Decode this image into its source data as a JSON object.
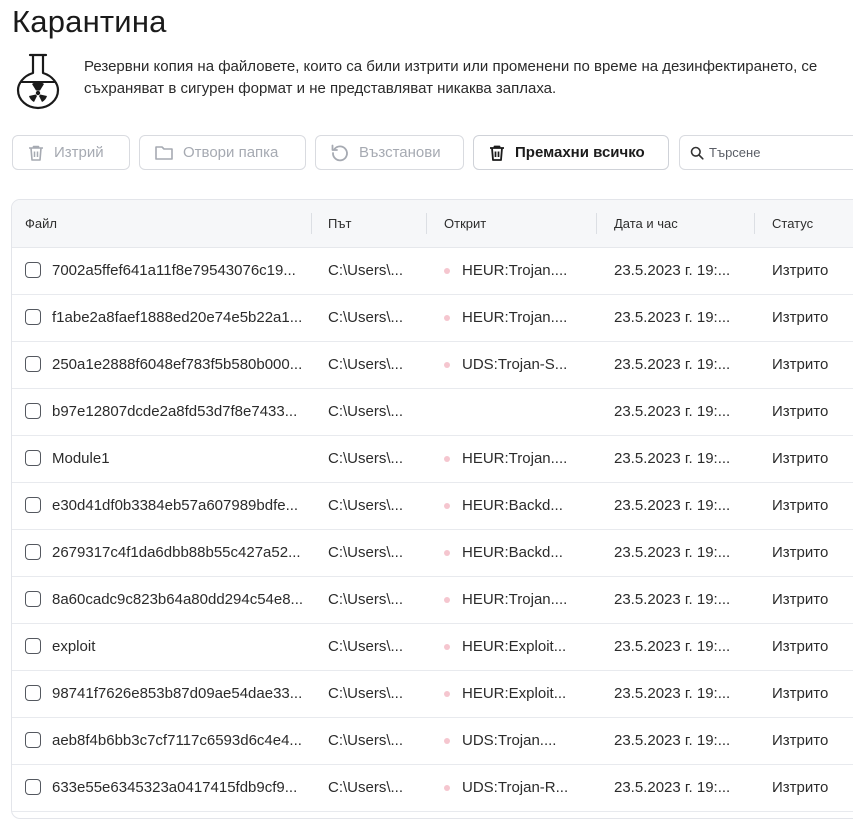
{
  "page": {
    "title": "Карантина",
    "description": "Резервни копия на файловете, които са били изтрити или променени по време на дезинфектирането, се съхраняват в сигурен формат и не представляват никаква заплаха.",
    "icon": "quarantine-flask-icon"
  },
  "toolbar": {
    "delete_label": "Изтрий",
    "open_folder_label": "Отвори папка",
    "restore_label": "Възстанови",
    "remove_all_label": "Премахни всичко",
    "search_placeholder": "Търсене"
  },
  "table": {
    "columns": [
      "Файл",
      "Път",
      "Открит",
      "Дата и час",
      "Статус"
    ],
    "rows": [
      {
        "file": "7002a5ffef641a11f8e79543076c19...",
        "path": "C:\\Users\\...",
        "detected": "HEUR:Trojan....",
        "datetime": "23.5.2023 г. 19:...",
        "status": "Изтрито"
      },
      {
        "file": "f1abe2a8faef1888ed20e74e5b22a1...",
        "path": "C:\\Users\\...",
        "detected": "HEUR:Trojan....",
        "datetime": "23.5.2023 г. 19:...",
        "status": "Изтрито"
      },
      {
        "file": "250a1e2888f6048ef783f5b580b000...",
        "path": "C:\\Users\\...",
        "detected": "UDS:Trojan-S...",
        "datetime": "23.5.2023 г. 19:...",
        "status": "Изтрито"
      },
      {
        "file": "b97e12807dcde2a8fd53d7f8e7433...",
        "path": "C:\\Users\\...",
        "detected": "",
        "datetime": "23.5.2023 г. 19:...",
        "status": "Изтрито"
      },
      {
        "file": "Module1",
        "path": "C:\\Users\\...",
        "detected": "HEUR:Trojan....",
        "datetime": "23.5.2023 г. 19:...",
        "status": "Изтрито"
      },
      {
        "file": "e30d41df0b3384eb57a607989bdfe...",
        "path": "C:\\Users\\...",
        "detected": "HEUR:Backd...",
        "datetime": "23.5.2023 г. 19:...",
        "status": "Изтрито"
      },
      {
        "file": "2679317c4f1da6dbb88b55c427a52...",
        "path": "C:\\Users\\...",
        "detected": "HEUR:Backd...",
        "datetime": "23.5.2023 г. 19:...",
        "status": "Изтрито"
      },
      {
        "file": "8a60cadc9c823b64a80dd294c54e8...",
        "path": "C:\\Users\\...",
        "detected": "HEUR:Trojan....",
        "datetime": "23.5.2023 г. 19:...",
        "status": "Изтрито"
      },
      {
        "file": "exploit",
        "path": "C:\\Users\\...",
        "detected": "HEUR:Exploit...",
        "datetime": "23.5.2023 г. 19:...",
        "status": "Изтрито"
      },
      {
        "file": "98741f7626e853b87d09ae54dae33...",
        "path": "C:\\Users\\...",
        "detected": "HEUR:Exploit...",
        "datetime": "23.5.2023 г. 19:...",
        "status": "Изтрито"
      },
      {
        "file": "aeb8f4b6bb3c7cf7117c6593d6c4e4...",
        "path": "C:\\Users\\...",
        "detected": "UDS:Trojan....",
        "datetime": "23.5.2023 г. 19:...",
        "status": "Изтрито"
      },
      {
        "file": "633e55e6345323a0417415fdb9cf9...",
        "path": "C:\\Users\\...",
        "detected": "UDS:Trojan-R...",
        "datetime": "23.5.2023 г. 19:...",
        "status": "Изтрито"
      }
    ]
  },
  "colors": {
    "threat_dot": "#f5c6cf",
    "disabled_text": "#a6aab2",
    "header_bg": "#f6f7f9"
  }
}
